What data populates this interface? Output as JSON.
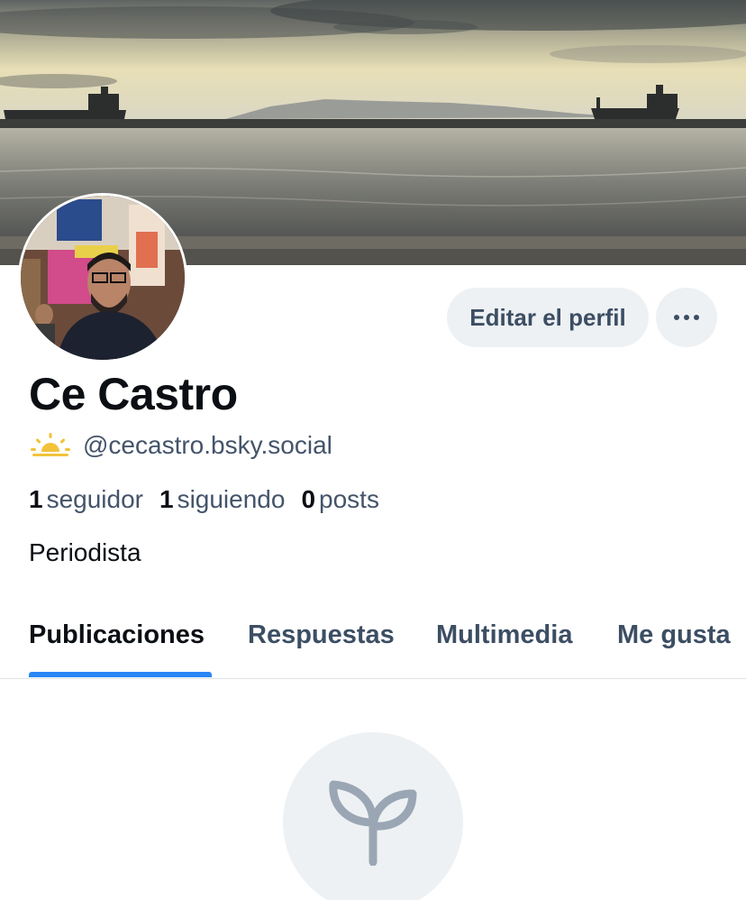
{
  "profile": {
    "display_name": "Ce Castro",
    "handle": "@cecastro.bsky.social",
    "bio": "Periodista",
    "badge_icon": "sunrise-icon"
  },
  "stats": {
    "followers_count": "1",
    "followers_label": "seguidor",
    "following_count": "1",
    "following_label": "siguiendo",
    "posts_count": "0",
    "posts_label": "posts"
  },
  "actions": {
    "edit_label": "Editar el perfil",
    "more_icon": "more-horizontal-icon"
  },
  "tabs": [
    {
      "label": "Publicaciones",
      "active": true
    },
    {
      "label": "Respuestas",
      "active": false
    },
    {
      "label": "Multimedia",
      "active": false
    },
    {
      "label": "Me gusta",
      "active": false
    }
  ],
  "empty_state": {
    "icon": "sprout-icon"
  },
  "colors": {
    "accent": "#2a86f5",
    "muted_text": "#44546a",
    "button_bg": "#eef1f4",
    "sun": "#f2c23a"
  }
}
